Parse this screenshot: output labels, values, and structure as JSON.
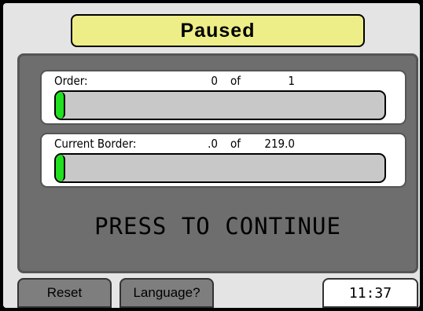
{
  "status": {
    "title": "Paused"
  },
  "progress": {
    "order": {
      "label": "Order:",
      "current": "0",
      "of": "of",
      "total": "1",
      "fraction": 0
    },
    "border": {
      "label": "Current Border:",
      "current": ".0",
      "of": "of",
      "total": "219.0",
      "fraction": 0
    }
  },
  "action": {
    "continue_label": "PRESS TO CONTINUE"
  },
  "footer": {
    "reset_label": "Reset",
    "language_label": "Language?",
    "clock": "11:37"
  },
  "colors": {
    "title_bg": "#eeee88",
    "panel_bg": "#6e6e6e",
    "progress_fill": "#20e020",
    "track_bg": "#c8c8c8"
  }
}
